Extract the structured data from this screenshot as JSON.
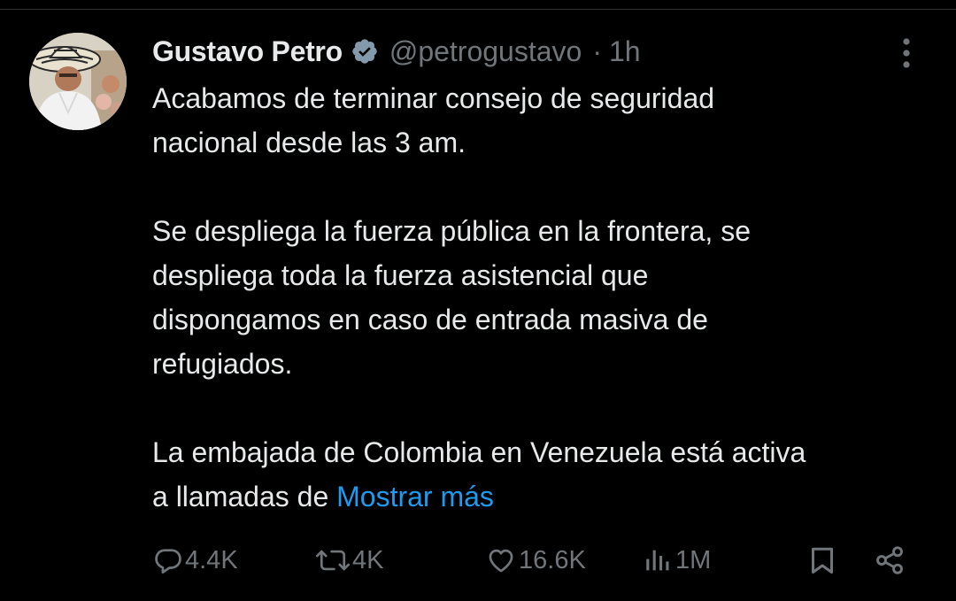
{
  "author": {
    "display_name": "Gustavo Petro",
    "handle": "@petrogustavo",
    "separator": "·",
    "time_ago": "1h",
    "verified": true,
    "verified_color": "#829aab"
  },
  "tweet": {
    "paragraphs": [
      [
        "Acabamos de terminar consejo de seguridad",
        "nacional desde las 3 am."
      ],
      [
        "Se despliega la fuerza pública en la frontera, se",
        "despliega toda la fuerza asistencial que",
        "dispongamos en caso de entrada masiva de",
        "refugiados."
      ]
    ],
    "last_line_1": "La embajada de Colombia en Venezuela está activa",
    "last_line_2": "a llamadas de",
    "show_more_label": "Mostrar más",
    "link_color": "#1d9bf0"
  },
  "metrics": {
    "replies": "4.4K",
    "reposts": "4K",
    "likes": "16.6K",
    "views": "1M"
  },
  "icons": {
    "reply": "speech-bubble-icon",
    "repost": "repost-arrows-icon",
    "like": "heart-icon",
    "views": "bar-chart-icon",
    "bookmark": "bookmark-icon",
    "share": "share-nodes-icon",
    "more": "vertical-ellipsis-icon",
    "verified": "verified-badge-icon"
  },
  "colors": {
    "background": "#000000",
    "text": "#e7e9ea",
    "muted": "#71767b"
  }
}
